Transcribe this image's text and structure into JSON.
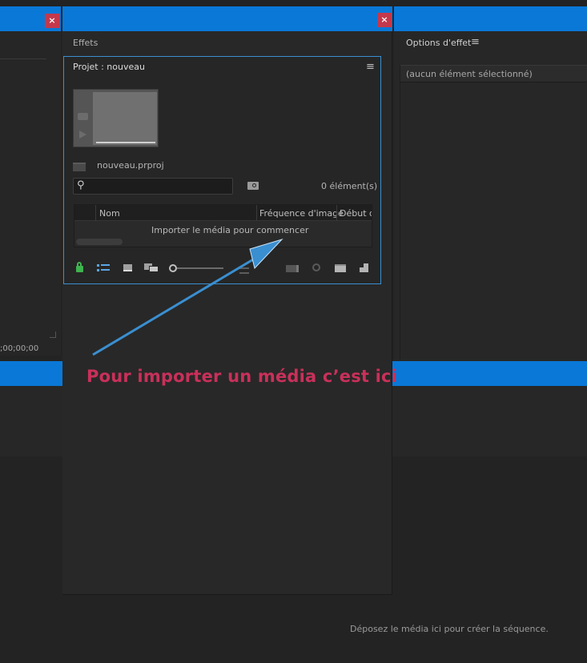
{
  "left_panel": {
    "close_label": "×",
    "timecode": ";00;00;00"
  },
  "effects_panel": {
    "title": "Effets",
    "close_label": "×"
  },
  "project_panel": {
    "title": "Projet : nouveau",
    "project_file": "nouveau.prproj",
    "item_count": "0 élément(s)",
    "columns": [
      "Nom",
      "Fréquence d'image",
      "Début d"
    ],
    "empty_message": "Importer le média pour commencer"
  },
  "effect_options": {
    "title": "Options d'effet",
    "no_selection": "(aucun élément sélectionné)"
  },
  "timeline": {
    "drop_hint": "Déposez le média ici pour créer la séquence."
  },
  "annotation": {
    "text": "Pour importer un média c’est ici",
    "color": "#c9305a",
    "arrow_color": "#3a8fd0"
  },
  "icons": {
    "menu": "≡",
    "search": "⚲",
    "lock": "lock-icon",
    "list_view": "list-view-icon",
    "icon_view": "icon-view-icon",
    "freeform_view": "freeform-view-icon",
    "zoom_slider": "zoom-slider-icon",
    "sort": "sort-icon",
    "automate": "automate-to-sequence-icon",
    "find": "find-icon",
    "new_bin": "new-bin-icon",
    "new_item": "new-item-icon"
  },
  "colors": {
    "accent_blue": "#0a78d7",
    "panel_bg": "#262626",
    "close_red": "#c4384c",
    "focus_border": "#3a8fd0"
  }
}
